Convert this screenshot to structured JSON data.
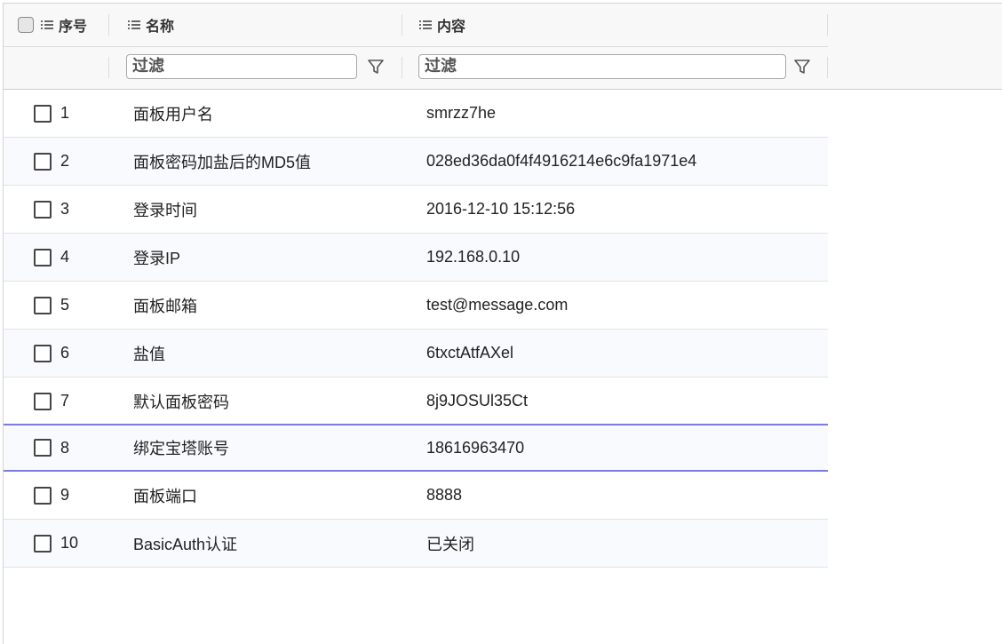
{
  "header": {
    "col_seq": "序号",
    "col_name": "名称",
    "col_content": "内容",
    "filter_name_placeholder": "过滤",
    "filter_content_placeholder": "过滤"
  },
  "rows": [
    {
      "seq": "1",
      "name": "面板用户名",
      "content": "smrzz7he"
    },
    {
      "seq": "2",
      "name": "面板密码加盐后的MD5值",
      "content": "028ed36da0f4f4916214e6c9fa1971e4"
    },
    {
      "seq": "3",
      "name": "登录时间",
      "content": "2016-12-10 15:12:56"
    },
    {
      "seq": "4",
      "name": "登录IP",
      "content": "192.168.0.10"
    },
    {
      "seq": "5",
      "name": "面板邮箱",
      "content": "test@message.com"
    },
    {
      "seq": "6",
      "name": "盐值",
      "content": "6txctAtfAXel"
    },
    {
      "seq": "7",
      "name": "默认面板密码",
      "content": "8j9JOSUl35Ct"
    },
    {
      "seq": "8",
      "name": "绑定宝塔账号",
      "content": "18616963470"
    },
    {
      "seq": "9",
      "name": "面板端口",
      "content": "8888"
    },
    {
      "seq": "10",
      "name": "BasicAuth认证",
      "content": "已关闭"
    }
  ],
  "selected_row": "8",
  "colors": {
    "selection_border": "#7b7be0",
    "header_bg": "#f8f8f8"
  }
}
